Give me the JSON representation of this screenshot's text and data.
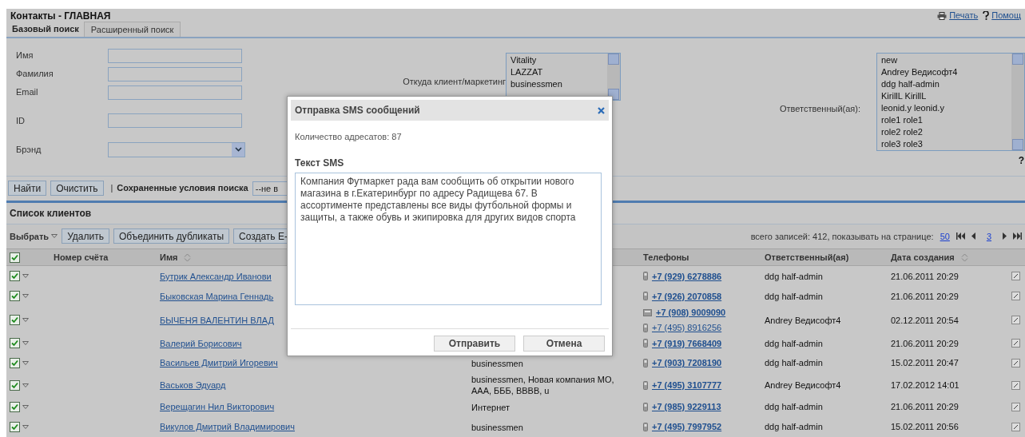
{
  "header": {
    "title": "Контакты - ГЛАВНАЯ",
    "links": [
      {
        "label": "Печать",
        "kind": "print"
      },
      {
        "label": "Помощ",
        "kind": "help"
      }
    ]
  },
  "tabs": [
    {
      "label": "Базовый поиск",
      "selected": true
    },
    {
      "label": "Расширенный поиск",
      "selected": false
    }
  ],
  "search_fields": [
    {
      "label": "Имя",
      "kind": "text"
    },
    {
      "label": "Фамилия",
      "kind": "text"
    },
    {
      "label": "Email",
      "kind": "text"
    },
    {
      "label": "ID",
      "kind": "text"
    },
    {
      "label": "Брэнд",
      "kind": "select"
    }
  ],
  "source_filter": {
    "label": "Откуда клиент/маркетинг",
    "options": [
      "Vitality",
      "LAZZAT",
      "businessmen"
    ]
  },
  "responsible_filter": {
    "label": "Ответственный(ая):",
    "options": [
      "new",
      "Andrey Ведисофт4",
      "ddg half-admin",
      "KirillL KirillL",
      "leonid.y leonid.y",
      "role1 role1",
      "role2 role2",
      "role3 role3"
    ]
  },
  "help_mark": "?",
  "search_actions": {
    "buttons": [
      "Найти",
      "Очистить"
    ],
    "separator": "|",
    "saved_label": "Сохраненные условия поиска",
    "saved_value": "--не в"
  },
  "client_list": {
    "title": "Список клиентов",
    "select_menu": "Выбрать",
    "actions": [
      "Удалить",
      "Объединить дубликаты",
      "Создать Е-"
    ],
    "summary": "всего записей: 412, показывать на странице:",
    "page_size": "50",
    "page": "3",
    "all_checked": true,
    "columns": {
      "account": {
        "label": "Номер счёта",
        "sortable": false
      },
      "name": {
        "label": "Имя",
        "sortable": true
      },
      "phones": {
        "label": "Телефоны",
        "sortable": false
      },
      "responsible": {
        "label": "Ответственный(ая)",
        "sortable": false
      },
      "created": {
        "label": "Дата создания",
        "sortable": true
      }
    },
    "rows": [
      {
        "checked": true,
        "name": "Бутрик Александр Иванови",
        "phones": [
          {
            "number": "+7 (929) 6278886",
            "kind": "mobile",
            "primary": true
          }
        ],
        "responsible": "ddg half-admin",
        "created": "21.06.2011 20:29"
      },
      {
        "checked": true,
        "name": "Быковская Марина Геннадь",
        "phones": [
          {
            "number": "+7 (926) 2070858",
            "kind": "mobile",
            "primary": true
          }
        ],
        "responsible": "ddg half-admin",
        "created": "21.06.2011 20:29"
      },
      {
        "checked": true,
        "name": "БЫЧЕНЯ ВАЛЕНТИН ВЛАД",
        "phones": [
          {
            "number": "+7 (908) 9009090",
            "kind": "landline",
            "primary": true
          },
          {
            "number": "+7 (495) 8916256",
            "kind": "mobile",
            "primary": false
          }
        ],
        "responsible": "Andrey Ведисофт4",
        "created": "02.12.2011 20:54"
      },
      {
        "checked": true,
        "name": "Валерий Борисович",
        "phones": [
          {
            "number": "+7 (919) 7668409",
            "kind": "mobile",
            "primary": true
          }
        ],
        "responsible": "ddg half-admin",
        "created": "21.06.2011 20:29"
      },
      {
        "checked": true,
        "name": "Васильев Дмитрий Игоревич",
        "column_3": "businessmen",
        "phones": [
          {
            "number": "+7 (903) 7208190",
            "kind": "mobile",
            "primary": true
          }
        ],
        "responsible": "ddg half-admin",
        "created": "15.02.2011 20:47"
      },
      {
        "checked": true,
        "name": "Васьков Эдуард",
        "column_3": "businessmen, Новая компания МО, ААА, БББ, ВВВВ, u",
        "phones": [
          {
            "number": "+7 (495) 3107777",
            "kind": "mobile",
            "primary": true
          }
        ],
        "responsible": "Andrey Ведисофт4",
        "created": "17.02.2012 14:01"
      },
      {
        "checked": true,
        "name": "Верещагин Нил Викторович",
        "column_3": "Интернет",
        "phones": [
          {
            "number": "+7 (985) 9229113",
            "kind": "mobile",
            "primary": true
          }
        ],
        "responsible": "ddg half-admin",
        "created": "21.06.2011 20:29"
      },
      {
        "checked": true,
        "name": "Викулов Дмитрий Владимирович",
        "column_3": "businessmen",
        "phones": [
          {
            "number": "+7 (495) 7997952",
            "kind": "mobile",
            "primary": true
          }
        ],
        "responsible": "ddg half-admin",
        "created": "15.02.2011 20:56"
      }
    ]
  },
  "dialog": {
    "title": "Отправка SMS сообщений",
    "recipients": "Количество адресатов: 87",
    "text_label": "Текст SMS",
    "text": "Компания Футмаркет рада вам сообщить об открытии нового магазина в г.Екатеринбург по адресу Радищева 67. В ассортименте представлены все виды футбольной формы и защиты, а также обувь и экипировка для других видов спорта",
    "buttons": [
      "Отправить",
      "Отмена"
    ]
  }
}
